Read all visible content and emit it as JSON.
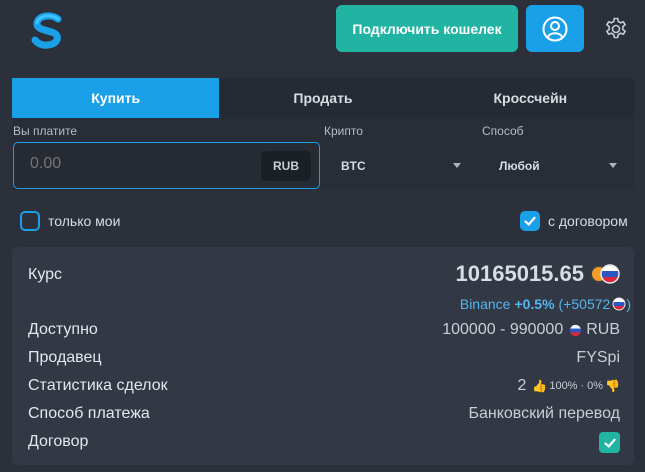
{
  "header": {
    "connect_wallet_label": "Подключить кошелек",
    "logo_icon": "s-logo-icon",
    "user_icon": "user-icon",
    "settings_icon": "gear-icon",
    "colors": {
      "accent": "#1aa0e8",
      "teal": "#22b4a3",
      "background": "#2b303b"
    }
  },
  "tabs": [
    {
      "label": "Купить",
      "active": true
    },
    {
      "label": "Продать",
      "active": false
    },
    {
      "label": "Кроссчейн",
      "active": false
    }
  ],
  "form": {
    "pay_label": "Вы платите",
    "amount_placeholder": "0.00",
    "amount_currency": "RUB",
    "crypto_label": "Крипто",
    "crypto_value": "BTC",
    "method_label": "Способ",
    "method_value": "Любой"
  },
  "filters": {
    "only_mine_label": "только мои",
    "only_mine_checked": false,
    "with_contract_label": "с договором",
    "with_contract_checked": true
  },
  "offer": {
    "rate_label": "Курс",
    "rate_value": "10165015.65",
    "binance_source": "Binance",
    "binance_delta_percent": "+0.5%",
    "binance_delta_value": "(+50572",
    "binance_close": ")",
    "available_label": "Доступно",
    "available_range": "100000 - 990000",
    "available_currency": "RUB",
    "seller_label": "Продавец",
    "seller_value": "FYSpi",
    "stats_label": "Статистика сделок",
    "stats_count": "2",
    "stats_positive": "100%",
    "stats_separator": "·",
    "stats_negative": "0%",
    "payment_label": "Способ платежа",
    "payment_value": "Банковский перевод",
    "contract_label": "Договор",
    "contract_checked": true
  }
}
